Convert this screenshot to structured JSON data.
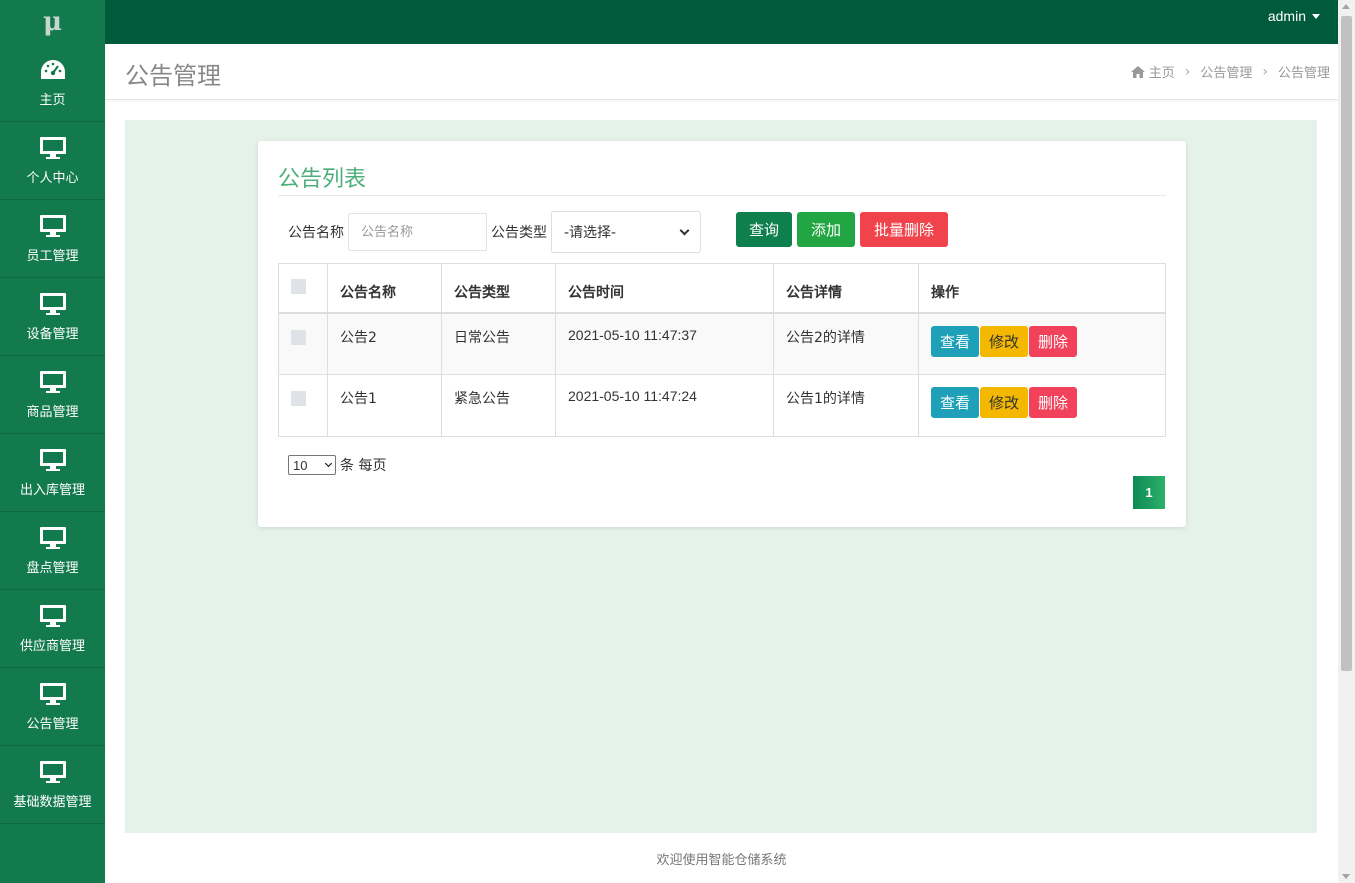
{
  "app": {
    "logo": "μ",
    "user": "admin"
  },
  "sidebar": {
    "items": [
      {
        "label": "主页",
        "icon": "dashboard-icon"
      },
      {
        "label": "个人中心",
        "icon": "monitor-icon"
      },
      {
        "label": "员工管理",
        "icon": "monitor-icon"
      },
      {
        "label": "设备管理",
        "icon": "monitor-icon"
      },
      {
        "label": "商品管理",
        "icon": "monitor-icon"
      },
      {
        "label": "出入库管理",
        "icon": "monitor-icon"
      },
      {
        "label": "盘点管理",
        "icon": "monitor-icon"
      },
      {
        "label": "供应商管理",
        "icon": "monitor-icon"
      },
      {
        "label": "公告管理",
        "icon": "monitor-icon"
      },
      {
        "label": "基础数据管理",
        "icon": "monitor-icon"
      }
    ]
  },
  "header": {
    "title": "公告管理",
    "breadcrumb": [
      "主页",
      "公告管理",
      "公告管理"
    ]
  },
  "card": {
    "title": "公告列表",
    "filter": {
      "name_label": "公告名称",
      "name_placeholder": "公告名称",
      "type_label": "公告类型",
      "type_selected": "-请选择-"
    },
    "buttons": {
      "query": "查询",
      "add": "添加",
      "batch_delete": "批量删除"
    },
    "table": {
      "columns": [
        "公告名称",
        "公告类型",
        "公告时间",
        "公告详情",
        "操作"
      ],
      "rows": [
        {
          "name": "公告2",
          "type": "日常公告",
          "time": "2021-05-10 11:47:37",
          "detail": "公告2的详情"
        },
        {
          "name": "公告1",
          "type": "紧急公告",
          "time": "2021-05-10 11:47:24",
          "detail": "公告1的详情"
        }
      ],
      "actions": {
        "view": "查看",
        "edit": "修改",
        "delete": "删除"
      }
    },
    "pagination": {
      "page_size": "10",
      "page_size_suffix": "条 每页",
      "current_page": "1"
    }
  },
  "footer": {
    "text": "欢迎使用智能仓储系统"
  },
  "colors": {
    "sidebar": "#127a4c",
    "topbar": "#005a3c",
    "content_bg": "#e5f2ea",
    "accent_title": "#4caf7a",
    "btn_query": "#0e7f4d",
    "btn_add": "#22a643",
    "btn_delete": "#f1434b",
    "btn_view": "#1ea0b8",
    "btn_edit": "#f5b800"
  }
}
